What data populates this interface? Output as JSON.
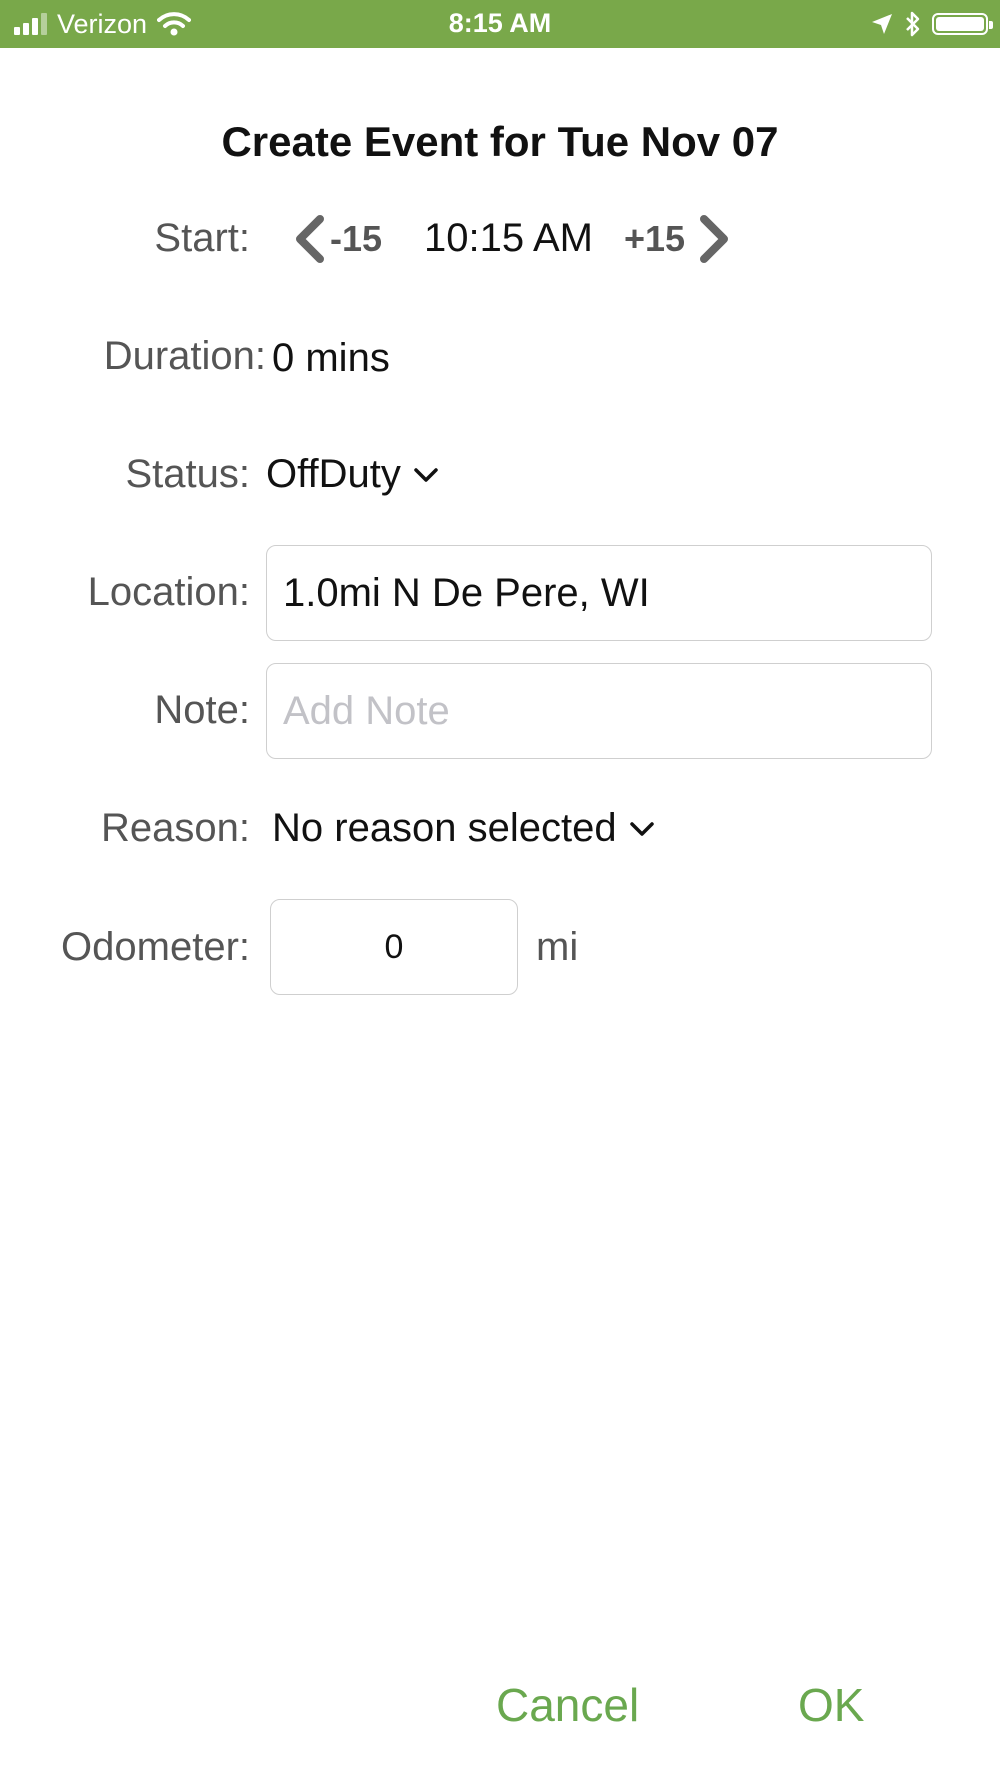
{
  "status_bar": {
    "carrier": "Verizon",
    "time": "8:15 AM",
    "color": "#79a84a"
  },
  "dialog": {
    "title": "Create Event for Tue Nov 07",
    "start": {
      "label": "Start:",
      "minus_label": "-15",
      "time": "10:15 AM",
      "plus_label": "+15"
    },
    "duration": {
      "label": "Duration:",
      "value": "0 mins"
    },
    "status": {
      "label": "Status:",
      "selected": "OffDuty"
    },
    "location": {
      "label": "Location:",
      "value": "1.0mi N De Pere, WI"
    },
    "note": {
      "label": "Note:",
      "placeholder": "Add Note",
      "value": ""
    },
    "reason": {
      "label": "Reason:",
      "selected": "No reason selected"
    },
    "odometer": {
      "label": "Odometer:",
      "value": "0",
      "unit": "mi"
    },
    "buttons": {
      "cancel": "Cancel",
      "ok": "OK",
      "accent": "#6aa84f"
    }
  }
}
